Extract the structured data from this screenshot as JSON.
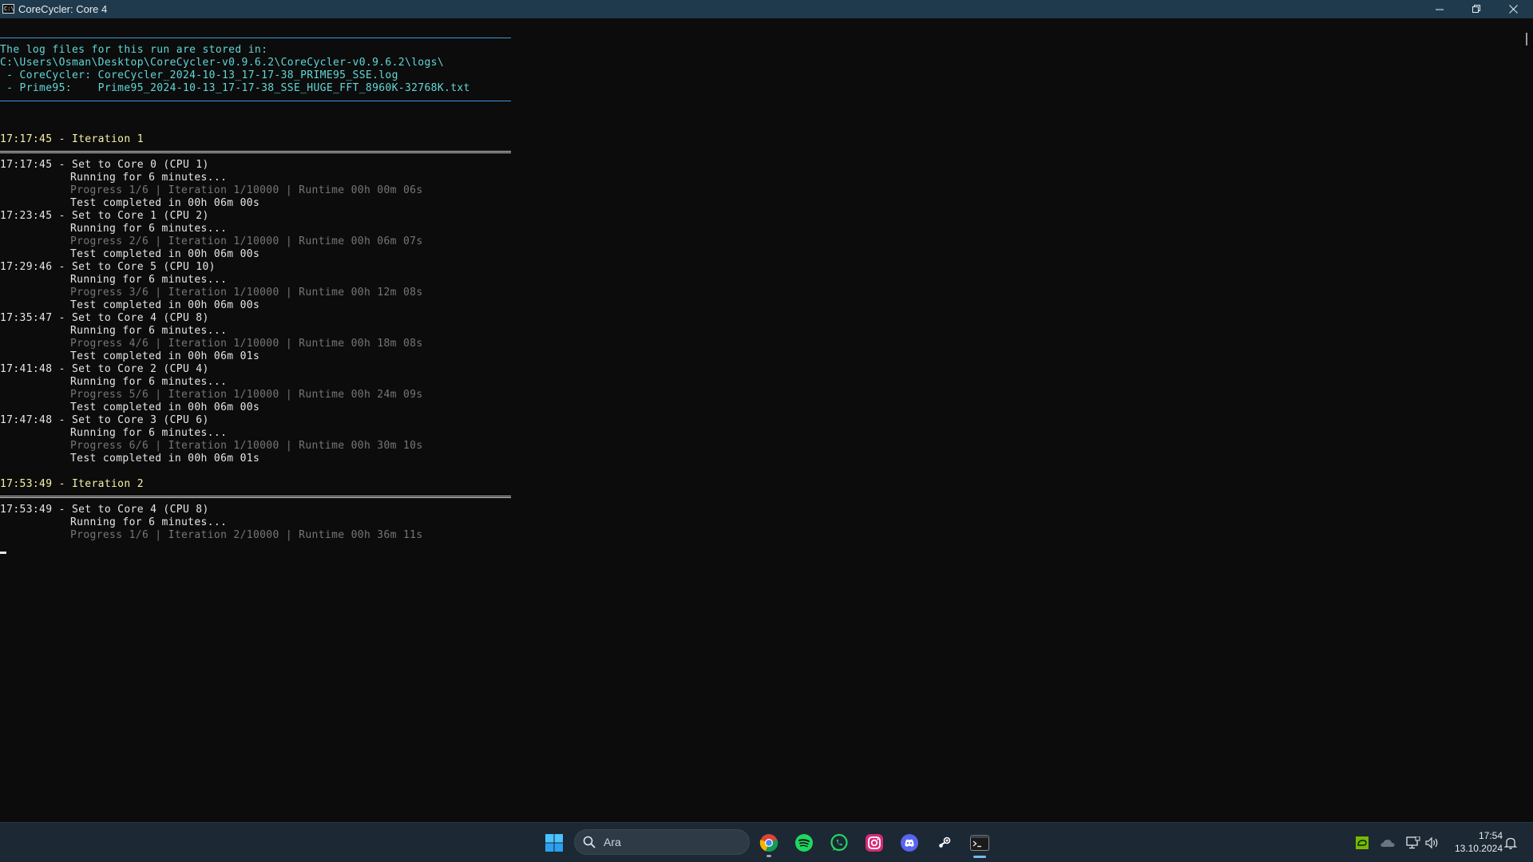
{
  "window": {
    "title": "CoreCycler: Core 4",
    "icon_label": "C:\\"
  },
  "header_lines": [
    "The log files for this run are stored in:",
    "C:\\Users\\Osman\\Desktop\\CoreCycler-v0.9.6.2\\CoreCycler-v0.9.6.2\\logs\\",
    " - CoreCycler: CoreCycler_2024-10-13_17-17-38_PRIME95_SSE.log",
    " - Prime95:    Prime95_2024-10-13_17-17-38_SSE_HUGE_FFT_8960K-32768K.txt"
  ],
  "iterations": [
    {
      "heading": "17:17:45 - Iteration 1",
      "cores": [
        {
          "set": "17:17:45 - Set to Core 0 (CPU 1)",
          "running": "Running for 6 minutes...",
          "progress": "Progress 1/6 | Iteration 1/10000 | Runtime 00h 00m 06s",
          "completed": "Test completed in 00h 06m 00s"
        },
        {
          "set": "17:23:45 - Set to Core 1 (CPU 2)",
          "running": "Running for 6 minutes...",
          "progress": "Progress 2/6 | Iteration 1/10000 | Runtime 00h 06m 07s",
          "completed": "Test completed in 00h 06m 00s"
        },
        {
          "set": "17:29:46 - Set to Core 5 (CPU 10)",
          "running": "Running for 6 minutes...",
          "progress": "Progress 3/6 | Iteration 1/10000 | Runtime 00h 12m 08s",
          "completed": "Test completed in 00h 06m 00s"
        },
        {
          "set": "17:35:47 - Set to Core 4 (CPU 8)",
          "running": "Running for 6 minutes...",
          "progress": "Progress 4/6 | Iteration 1/10000 | Runtime 00h 18m 08s",
          "completed": "Test completed in 00h 06m 01s"
        },
        {
          "set": "17:41:48 - Set to Core 2 (CPU 4)",
          "running": "Running for 6 minutes...",
          "progress": "Progress 5/6 | Iteration 1/10000 | Runtime 00h 24m 09s",
          "completed": "Test completed in 00h 06m 00s"
        },
        {
          "set": "17:47:48 - Set to Core 3 (CPU 6)",
          "running": "Running for 6 minutes...",
          "progress": "Progress 6/6 | Iteration 1/10000 | Runtime 00h 30m 10s",
          "completed": "Test completed in 00h 06m 01s"
        }
      ]
    },
    {
      "heading": "17:53:49 - Iteration 2",
      "cores": [
        {
          "set": "17:53:49 - Set to Core 4 (CPU 8)",
          "running": "Running for 6 minutes...",
          "progress": "Progress 1/6 | Iteration 2/10000 | Runtime 00h 36m 11s"
        }
      ]
    }
  ],
  "taskbar": {
    "search_placeholder": "Ara",
    "apps": [
      "start-icon",
      "chrome-icon",
      "spotify-icon",
      "whatsapp-icon",
      "instagram-icon",
      "discord-icon",
      "steam-icon",
      "terminal-icon"
    ],
    "tray_icons": [
      "nvidia-icon",
      "onedrive-icon",
      "network-icon",
      "volume-icon",
      "notification-bell-icon"
    ],
    "time": "17:54",
    "date": "13.10.2024"
  },
  "colors": {
    "console_bg": "#0c0c0c",
    "header_text": "#61d6d6",
    "iteration_text": "#f9f1a5",
    "progress_text": "#767676",
    "titlebar_bg": "#1f3a4c",
    "taskbar_bg": "#1c2833"
  }
}
